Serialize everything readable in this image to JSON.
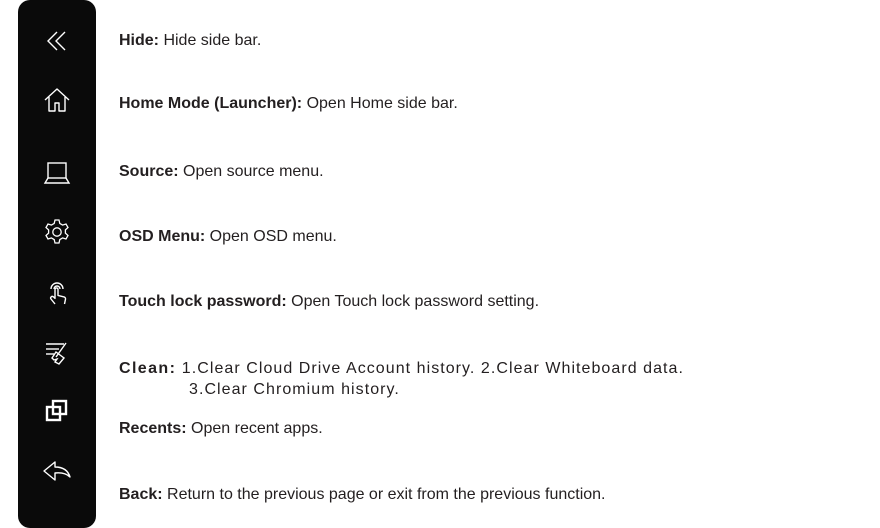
{
  "sidebar": {
    "icons": [
      "hide-icon",
      "home-icon",
      "laptop-icon",
      "gear-icon",
      "touch-lock-icon",
      "clean-icon",
      "recents-icon",
      "back-icon"
    ]
  },
  "items": [
    {
      "term": "Hide:",
      "desc": " Hide side bar."
    },
    {
      "term": "Home Mode (Launcher):",
      "desc": " Open Home side bar."
    },
    {
      "term": "Source:",
      "desc": " Open source menu."
    },
    {
      "term": "OSD Menu:",
      "desc": " Open OSD menu."
    },
    {
      "term": "Touch lock password:",
      "desc": " Open Touch lock password setting."
    },
    {
      "term": "Clean:",
      "desc": " 1.Clear Cloud Drive Account history. 2.Clear Whiteboard data.",
      "desc2": "3.Clear Chromium history."
    },
    {
      "term": "Recents:",
      "desc": " Open recent apps."
    },
    {
      "term": "Back:",
      "desc": " Return to the previous page or exit from the previous function."
    }
  ]
}
